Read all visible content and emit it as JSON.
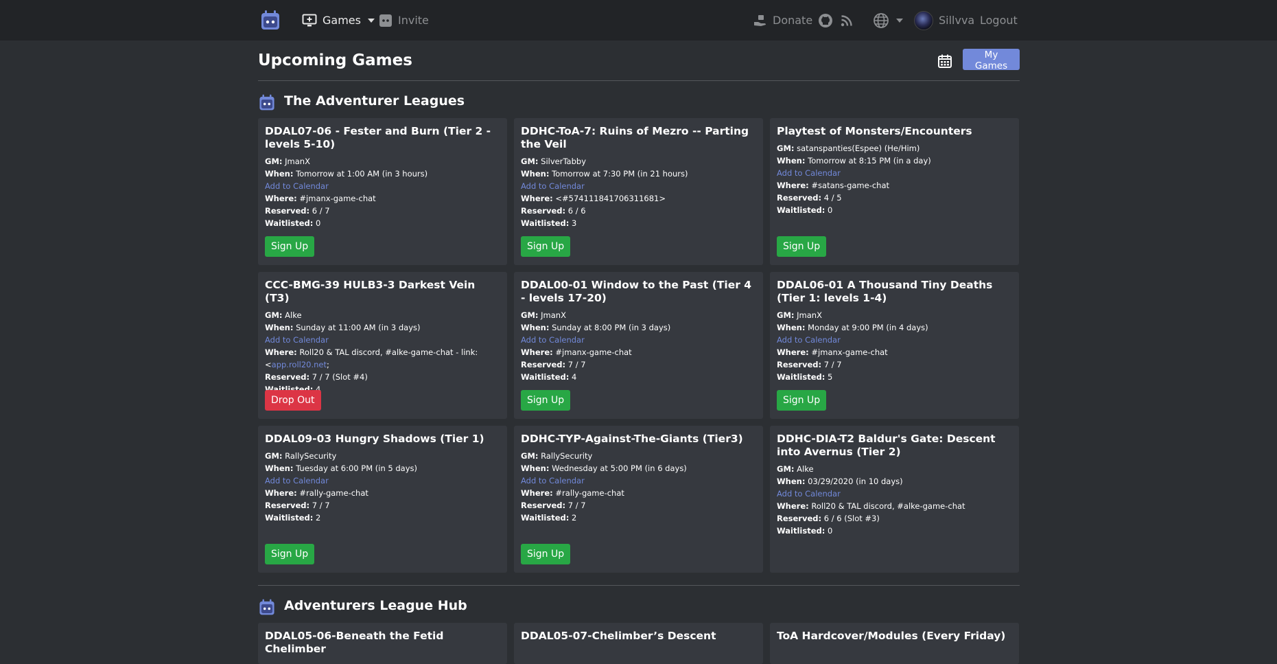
{
  "nav": {
    "games_label": "Games",
    "invite_label": "Invite",
    "donate_label": "Donate",
    "user_name": "Sillvva",
    "logout_label": "Logout"
  },
  "header": {
    "title": "Upcoming Games",
    "my_games_label": "My Games"
  },
  "labels": {
    "gm": "GM:",
    "when": "When:",
    "where": "Where:",
    "reserved": "Reserved:",
    "waitlisted": "Waitlisted:",
    "add_to_calendar": "Add to Calendar"
  },
  "sections": [
    {
      "title": "The Adventurer Leagues",
      "games": [
        {
          "title": "DDAL07-06 - Fester and Burn (Tier 2 - levels 5-10)",
          "gm": "JmanX",
          "when": "Tomorrow at 1:00 AM (in 3 hours)",
          "where": "#jmanx-game-chat",
          "reserved": "6 / 7",
          "waitlisted": "0",
          "action": "Sign Up"
        },
        {
          "title": "DDHC-ToA-7: Ruins of Mezro -- Parting the Veil",
          "gm": "SilverTabby",
          "when": "Tomorrow at 7:30 PM (in 21 hours)",
          "where": "<#574111841706311681>",
          "reserved": "6 / 6",
          "waitlisted": "3",
          "action": "Sign Up"
        },
        {
          "title": "Playtest of Monsters/Encounters",
          "gm": "satanspanties(Espee) (He/Him)",
          "when": "Tomorrow at 8:15 PM (in a day)",
          "where": "#satans-game-chat",
          "reserved": "4 / 5",
          "waitlisted": "0",
          "action": "Sign Up"
        },
        {
          "title": "CCC-BMG-39 HULB3-3 Darkest Vein (T3)",
          "gm": "Alke",
          "when": "Sunday at 11:00 AM (in 3 days)",
          "where": "Roll20 & TAL discord, #alke-game-chat - link:",
          "where_link": "app.roll20.net",
          "where_suffix": ";",
          "reserved": "7 / 7 (Slot #4)",
          "waitlisted": "4",
          "action": "Drop Out"
        },
        {
          "title": "DDAL00-01 Window to the Past (Tier 4 - levels 17-20)",
          "gm": "JmanX",
          "when": "Sunday at 8:00 PM (in 3 days)",
          "where": "#jmanx-game-chat",
          "reserved": "7 / 7",
          "waitlisted": "4",
          "action": "Sign Up"
        },
        {
          "title": "DDAL06-01 A Thousand Tiny Deaths (Tier 1: levels 1-4)",
          "gm": "JmanX",
          "when": "Monday at 9:00 PM (in 4 days)",
          "where": "#jmanx-game-chat",
          "reserved": "7 / 7",
          "waitlisted": "5",
          "action": "Sign Up"
        },
        {
          "title": "DDAL09-03 Hungry Shadows (Tier 1)",
          "gm": "RallySecurity",
          "when": "Tuesday at 6:00 PM (in 5 days)",
          "where": "#rally-game-chat",
          "reserved": "7 / 7",
          "waitlisted": "2",
          "action": "Sign Up"
        },
        {
          "title": "DDHC-TYP-Against-The-Giants (Tier3)",
          "gm": "RallySecurity",
          "when": "Wednesday at 5:00 PM (in 6 days)",
          "where": "#rally-game-chat",
          "reserved": "7 / 7",
          "waitlisted": "2",
          "action": "Sign Up"
        },
        {
          "title": "DDHC-DIA-T2 Baldur's Gate: Descent into Avernus (Tier 2)",
          "gm": "Alke",
          "when": "03/29/2020 (in 10 days)",
          "where": "Roll20 & TAL discord, #alke-game-chat",
          "reserved": "6 / 6 (Slot #3)",
          "waitlisted": "0",
          "action": ""
        }
      ]
    },
    {
      "title": "Adventurers League Hub",
      "games": [
        {
          "title": "DDAL05-06-Beneath the Fetid Chelimber"
        },
        {
          "title": "DDAL05-07-Chelimber’s Descent"
        },
        {
          "title": "ToA Hardcover/Modules (Every Friday)"
        }
      ]
    }
  ],
  "colors": {
    "background": "#2c2f33",
    "navbar": "#222427",
    "card": "#36393f",
    "accent": "#7289da",
    "success": "#28a745",
    "danger": "#dc3545"
  }
}
